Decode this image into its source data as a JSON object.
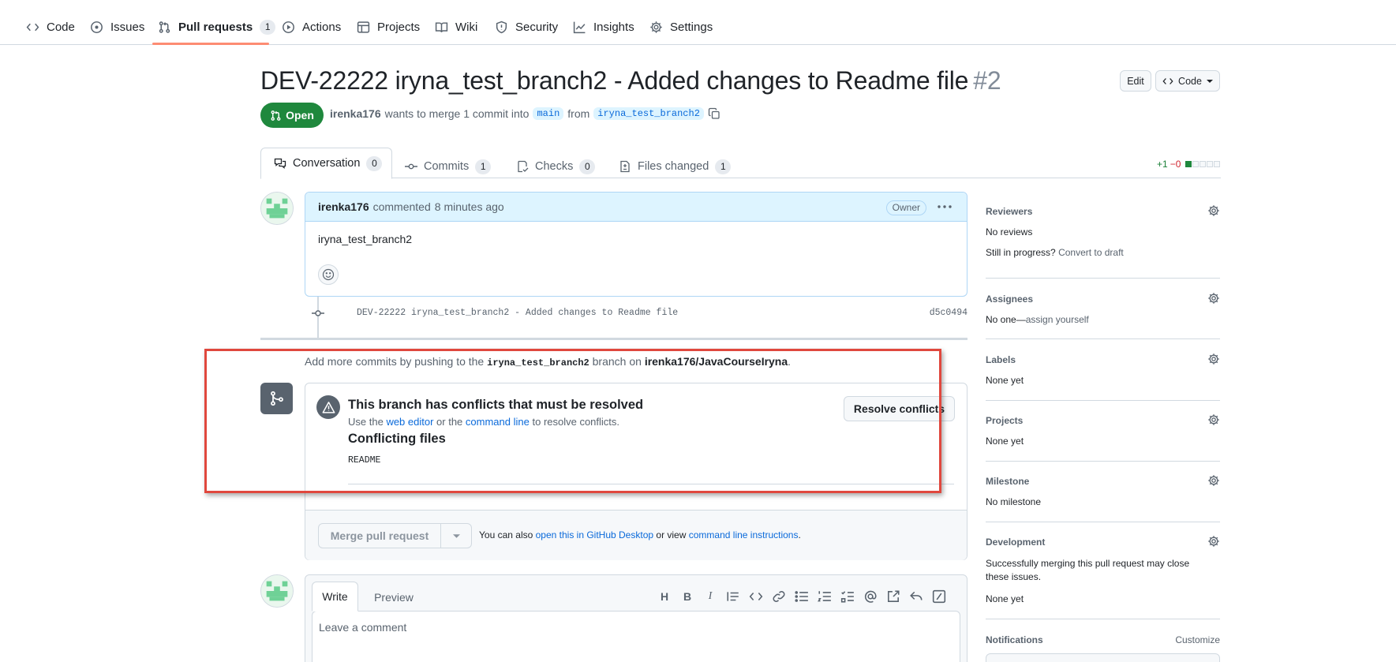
{
  "repo_nav": {
    "items": [
      {
        "label": "Code",
        "icon": "code-icon"
      },
      {
        "label": "Issues",
        "icon": "issue-icon"
      },
      {
        "label": "Pull requests",
        "icon": "pull-request-icon",
        "count": "1",
        "active": true
      },
      {
        "label": "Actions",
        "icon": "play-icon"
      },
      {
        "label": "Projects",
        "icon": "table-icon"
      },
      {
        "label": "Wiki",
        "icon": "book-icon"
      },
      {
        "label": "Security",
        "icon": "shield-icon"
      },
      {
        "label": "Insights",
        "icon": "graph-icon"
      },
      {
        "label": "Settings",
        "icon": "gear-icon"
      }
    ]
  },
  "pr": {
    "title": "DEV-22222 iryna_test_branch2 - Added changes to Readme file",
    "number": "#2",
    "edit_label": "Edit",
    "code_label": "Code",
    "state": "Open",
    "author": "irenka176",
    "merge_text": "wants to merge 1 commit into",
    "base_branch": "main",
    "from_text": "from",
    "head_branch": "iryna_test_branch2"
  },
  "tabs": [
    {
      "label": "Conversation",
      "count": "0",
      "active": true
    },
    {
      "label": "Commits",
      "count": "1"
    },
    {
      "label": "Checks",
      "count": "0"
    },
    {
      "label": "Files changed",
      "count": "1"
    }
  ],
  "diffstat": {
    "additions": "+1",
    "deletions": "−0",
    "blocks_added": 1,
    "blocks_total": 5
  },
  "comment": {
    "author": "irenka176",
    "action": "commented",
    "time": "8 minutes ago",
    "badge": "Owner",
    "body": "iryna_test_branch2"
  },
  "commit": {
    "message": "DEV-22222 iryna_test_branch2 - Added changes to Readme file",
    "sha": "d5c0494"
  },
  "push_hint": {
    "prefix": "Add more commits by pushing to the",
    "branch": "iryna_test_branch2",
    "middle": "branch on",
    "repo": "irenka176/JavaCourseIryna",
    "suffix": "."
  },
  "merge_box": {
    "conflict_title": "This branch has conflicts that must be resolved",
    "conflict_sub_1": "Use the",
    "web_editor_link": "web editor",
    "conflict_sub_2": "or the",
    "command_line_link": "command line",
    "conflict_sub_3": "to resolve conflicts.",
    "resolve_button": "Resolve conflicts",
    "conflicting_files_title": "Conflicting files",
    "files": [
      "README"
    ],
    "merge_button": "Merge pull request",
    "tip_prefix": "You can also",
    "desktop_link": "open this in GitHub Desktop",
    "tip_middle": "or view",
    "instructions_link": "command line instructions",
    "tip_suffix": "."
  },
  "write_box": {
    "write_tab": "Write",
    "preview_tab": "Preview",
    "placeholder": "Leave a comment"
  },
  "sidebar": {
    "reviewers": {
      "title": "Reviewers",
      "value": "No reviews",
      "progress_text": "Still in progress?",
      "draft_link": "Convert to draft"
    },
    "assignees": {
      "title": "Assignees",
      "value": "No one—",
      "assign_link": "assign yourself"
    },
    "labels": {
      "title": "Labels",
      "value": "None yet"
    },
    "projects": {
      "title": "Projects",
      "value": "None yet"
    },
    "milestone": {
      "title": "Milestone",
      "value": "No milestone"
    },
    "development": {
      "title": "Development",
      "description": "Successfully merging this pull request may close these issues.",
      "value": "None yet"
    },
    "notifications": {
      "title": "Notifications",
      "customize": "Customize"
    }
  },
  "colors": {
    "accent": "#0969da",
    "open_green": "#1f883d",
    "annotation_red": "#e0473d"
  }
}
